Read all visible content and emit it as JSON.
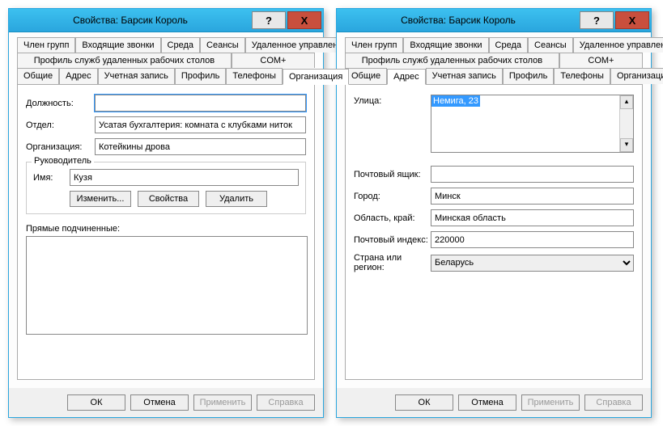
{
  "title": "Свойства: Барсик Король",
  "help": "?",
  "close": "X",
  "tabs": {
    "member_of": "Член групп",
    "incoming": "Входящие звонки",
    "env": "Среда",
    "sessions": "Сеансы",
    "remote": "Удаленное управление",
    "rdp_profile": "Профиль служб удаленных рабочих столов",
    "com": "COM+",
    "general": "Общие",
    "address": "Адрес",
    "account": "Учетная запись",
    "profile": "Профиль",
    "phones": "Телефоны",
    "org": "Организация"
  },
  "org": {
    "position_label": "Должность:",
    "position": "",
    "dept_label": "Отдел:",
    "dept": "Усатая бухгалтерия: комната с клубками ниток",
    "company_label": "Организация:",
    "company": "Котейкины дрова",
    "manager_group": "Руководитель",
    "mgr_name_label": "Имя:",
    "mgr_name": "Кузя",
    "btn_change": "Изменить...",
    "btn_props": "Свойства",
    "btn_delete": "Удалить",
    "reports_label": "Прямые подчиненные:"
  },
  "addr": {
    "street_label": "Улица:",
    "street": "Немига, 23",
    "pobox_label": "Почтовый ящик:",
    "pobox": "",
    "city_label": "Город:",
    "city": "Минск",
    "region_label": "Область, край:",
    "region": "Минская область",
    "zip_label": "Почтовый индекс:",
    "zip": "220000",
    "country_label": "Страна или регион:",
    "country": "Беларусь"
  },
  "footer": {
    "ok": "ОК",
    "cancel": "Отмена",
    "apply": "Применить",
    "help": "Справка"
  }
}
